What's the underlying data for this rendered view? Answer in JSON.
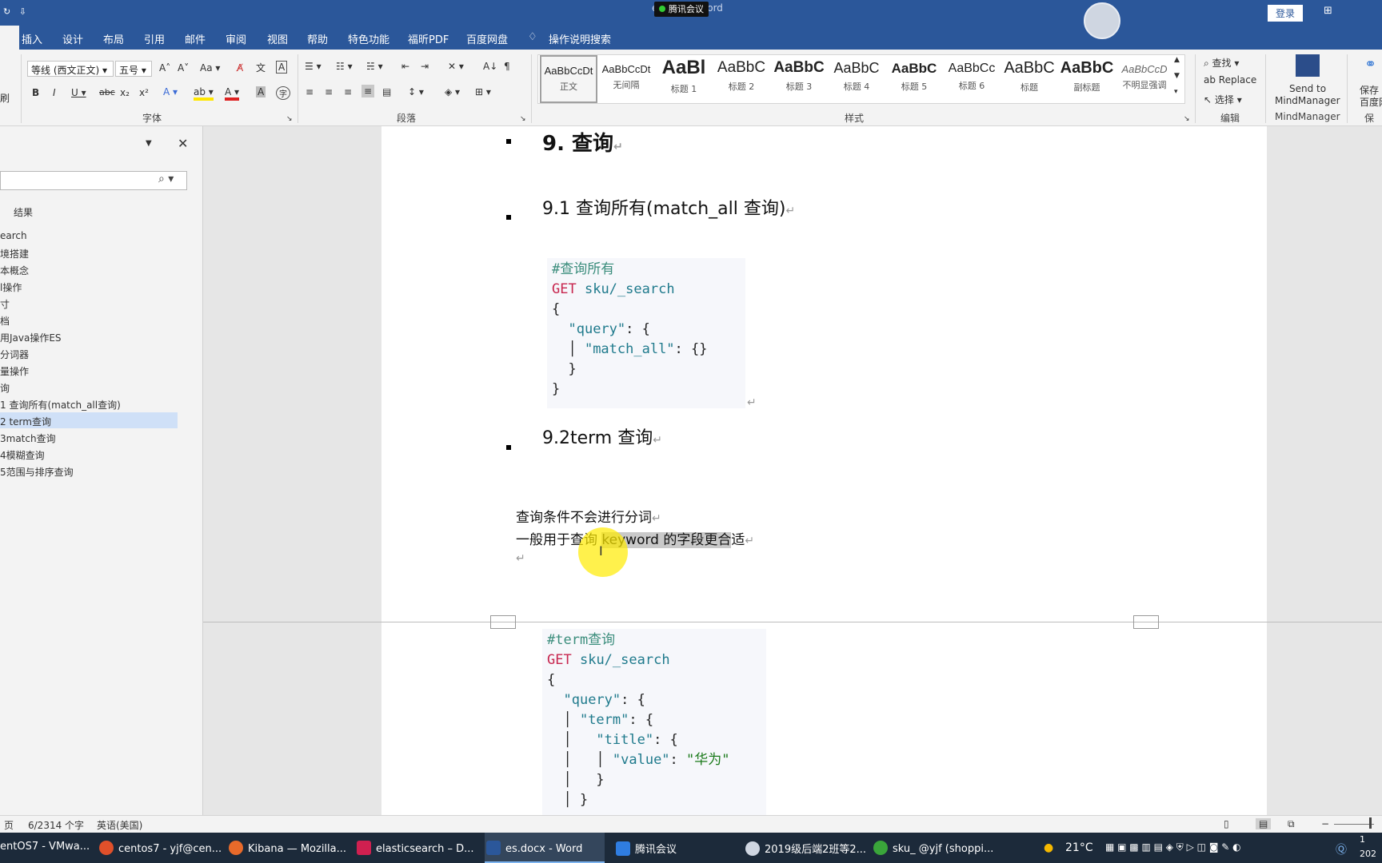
{
  "window": {
    "title": "es.docx - Word",
    "meeting_badge": "腾讯会议",
    "login": "登录"
  },
  "ribbon_tabs": [
    "插入",
    "设计",
    "布局",
    "引用",
    "邮件",
    "审阅",
    "视图",
    "帮助",
    "特色功能",
    "福昕PDF",
    "百度网盘",
    "操作说明搜索"
  ],
  "ribbon": {
    "font_name": "等线 (西文正文)",
    "font_size": "五号",
    "font_group": "字体",
    "paragraph_group": "段落",
    "styles_group": "样式",
    "edit_group": "编辑",
    "mindmanager_group": "MindManager",
    "find": "查找",
    "replace": "Replace",
    "select": "选择",
    "send_to": "Send to",
    "mindmanager": "MindManager",
    "save_to": "保存",
    "baidu_pan": "百度网",
    "save_group": "保存",
    "styles": [
      {
        "preview": "AaBbCcDt",
        "name": "正文"
      },
      {
        "preview": "AaBbCcDt",
        "name": "无间隔"
      },
      {
        "preview": "AaBl",
        "name": "标题 1"
      },
      {
        "preview": "AaBbC",
        "name": "标题 2"
      },
      {
        "preview": "AaBbC",
        "name": "标题 3"
      },
      {
        "preview": "AaBbC",
        "name": "标题 4"
      },
      {
        "preview": "AaBbC",
        "name": "标题 5"
      },
      {
        "preview": "AaBbCc",
        "name": "标题 6"
      },
      {
        "preview": "AaBbC",
        "name": "标题"
      },
      {
        "preview": "AaBbC",
        "name": "副标题"
      },
      {
        "preview": "AaBbCcD",
        "name": "不明显强调"
      }
    ]
  },
  "nav": {
    "results_label": "结果",
    "items": [
      "earch",
      "境搭建",
      "本概念",
      "l操作",
      "寸",
      "档",
      "用Java操作ES",
      "分词器",
      "量操作",
      "询",
      "1 查询所有(match_all查询)",
      "2 term查询",
      "3match查询",
      "4模糊查询",
      "5范围与排序查询"
    ]
  },
  "document": {
    "h1": "9. 查询",
    "h2_1": "9.1 查询所有(match_all 查询)",
    "h2_2": "9.2term 查询",
    "para1": "查询条件不会进行分词",
    "para2_pre": "一般用于查询 ",
    "para2_hl": "keyword 的字段更合",
    "para2_post": "适",
    "para_mark": "↵",
    "code1": {
      "comment": "#查询所有",
      "method": "GET",
      "url": "sku/_search",
      "l3": "{",
      "k_query": "\"query\"",
      "k_match_all": "\"match_all\"",
      "l_obj": ": {}",
      "colon_brace": ": {",
      "close_inner": "}",
      "close_outer": "}"
    },
    "code2": {
      "comment": "#term查询",
      "method": "GET",
      "url": "sku/_search",
      "l3": "{",
      "k_query": "\"query\"",
      "k_term": "\"term\"",
      "k_title": "\"title\"",
      "k_value": "\"value\"",
      "v_value": "\"华为\"",
      "colon_brace": ": {",
      "colon": ": ",
      "close": "}"
    }
  },
  "status": {
    "page": "页",
    "words": "6/2314 个字",
    "lang": "英语(美国)"
  },
  "taskbar": [
    {
      "label": "entOS7 - VMwa...",
      "color": "#6aa3d8"
    },
    {
      "label": "centos7 - yjf@cen...",
      "color": "#e0502a"
    },
    {
      "label": "Kibana — Mozilla...",
      "color": "#e86a2a"
    },
    {
      "label": "elasticsearch – D...",
      "color": "#d02050"
    },
    {
      "label": "es.docx - Word",
      "color": "#2b579a"
    },
    {
      "label": "腾讯会议",
      "color": "#2f7de1"
    },
    {
      "label": "2019级后端2班等2...",
      "color": "#cfd6e1"
    },
    {
      "label": "sku_ @yjf (shoppi...",
      "color": "#3aa53a"
    }
  ],
  "tray": {
    "temp": "21°C",
    "time": "1",
    "date": "202"
  }
}
